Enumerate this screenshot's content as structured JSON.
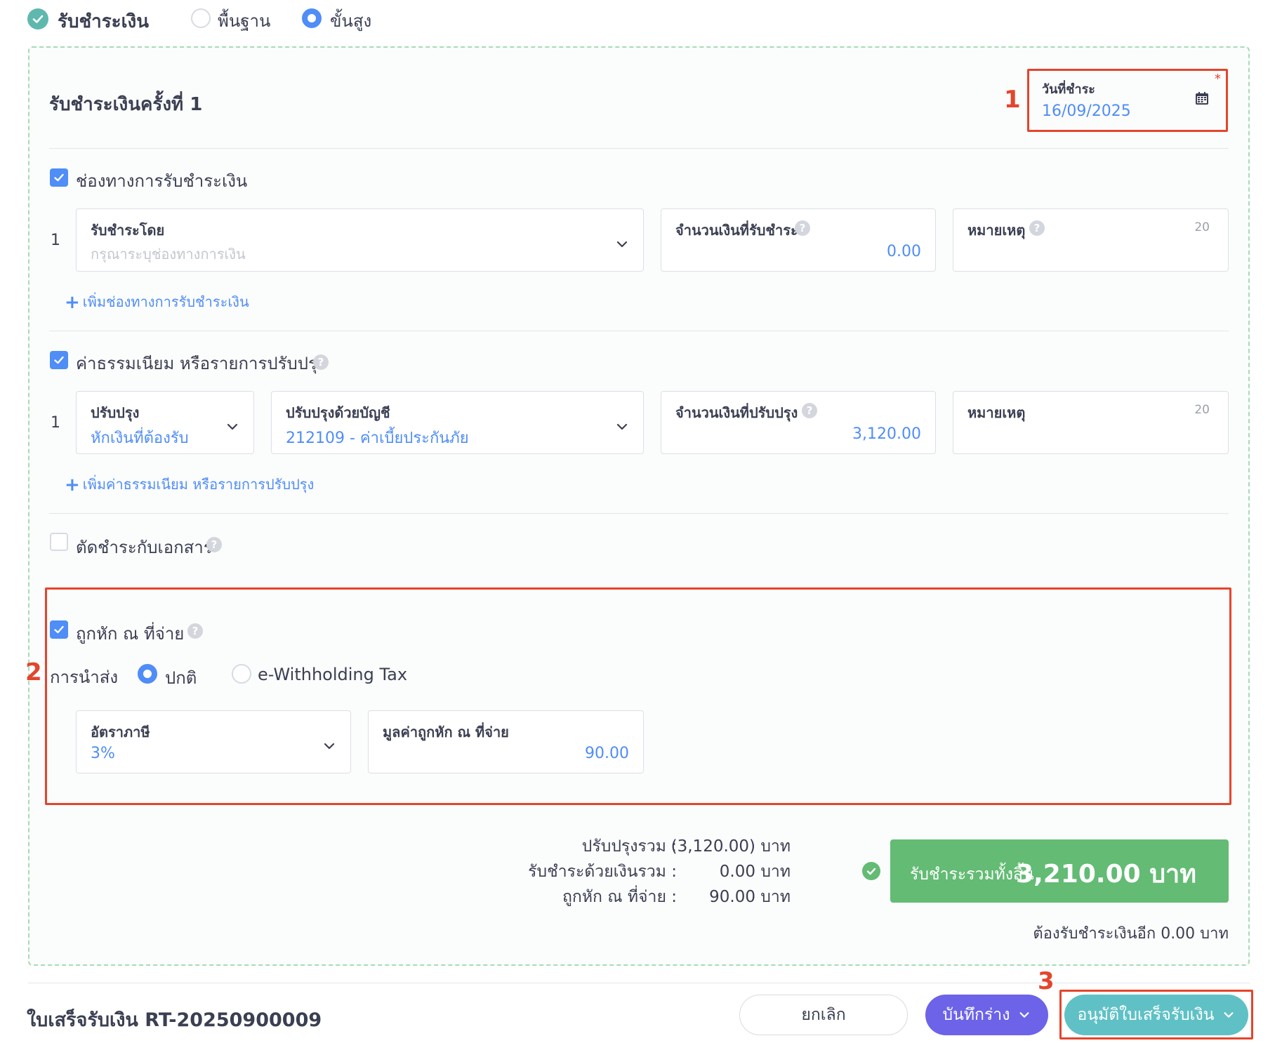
{
  "header": {
    "title": "รับชำระเงิน",
    "mode_basic": "พื้นฐาน",
    "mode_advanced": "ขั้นสูง",
    "selected_mode": "advanced"
  },
  "payment": {
    "section_title": "รับชำระเงินครั้งที่ 1",
    "date_label": "วันที่ชำระ",
    "date_value": "16/09/2025",
    "required_mark": "*"
  },
  "channels": {
    "title": "ช่องทางการรับชำระเงิน",
    "checked": true,
    "row_number": "1",
    "method_label": "รับชำระโดย",
    "method_placeholder": "กรุณาระบุช่องทางการเงิน",
    "amount_label": "จำนวนเงินที่รับชำระ",
    "amount_value": "0.00",
    "note_label": "หมายเหตุ",
    "note_counter": "20",
    "add_link": "เพิ่มช่องทางการรับชำระเงิน"
  },
  "fees": {
    "title": "ค่าธรรมเนียม หรือรายการปรับปรุง",
    "checked": true,
    "row_number": "1",
    "adjust_label": "ปรับปรุง",
    "adjust_value": "หักเงินที่ต้องรับ",
    "account_label": "ปรับปรุงด้วยบัญชี",
    "account_value": "212109 - ค่าเบี้ยประกันภัย",
    "amount_label": "จำนวนเงินที่ปรับปรุง",
    "amount_value": "3,120.00",
    "note_label": "หมายเหตุ",
    "note_counter": "20",
    "add_link": "เพิ่มค่าธรรมเนียม หรือรายการปรับปรุง"
  },
  "offset": {
    "title": "ตัดชำระกับเอกสาร",
    "checked": false
  },
  "withholding": {
    "title": "ถูกหัก ณ ที่จ่าย",
    "checked": true,
    "delivery_label": "การนำส่ง",
    "option_normal": "ปกติ",
    "option_ewht": "e-Withholding Tax",
    "selected_option": "normal",
    "rate_label": "อัตราภาษี",
    "rate_value": "3%",
    "amount_label": "มูลค่าถูกหัก ณ ที่จ่าย",
    "amount_value": "90.00"
  },
  "summary": {
    "adjust_total_label": "ปรับปรุงรวม :",
    "adjust_total_value": "(3,120.00) บาท",
    "cash_total_label": "รับชำระด้วยเงินรวม :",
    "cash_total_value": "0.00 บาท",
    "wht_total_label": "ถูกหัก ณ ที่จ่าย :",
    "wht_total_value": "90.00 บาท",
    "grand_total_label": "รับชำระรวมทั้งสิ้น",
    "grand_total_value": "3,210.00 บาท",
    "remaining": "ต้องรับชำระเงินอีก 0.00 บาท"
  },
  "annotations": {
    "marker_1": "1",
    "marker_2": "2",
    "marker_3": "3"
  },
  "footer": {
    "document_title": "ใบเสร็จรับเงิน RT-20250900009",
    "cancel_label": "ยกเลิก",
    "draft_label": "บันทึกร่าง",
    "approve_label": "อนุมัติใบเสร็จรับเงิน"
  },
  "colors": {
    "accent_blue": "#4f8df7",
    "success_green": "#63bb74",
    "annotation_red": "#e4452c",
    "draft_purple": "#6c63e9",
    "approve_teal": "#5fc1c5"
  },
  "icons": [
    "check-circle-icon",
    "calendar-icon",
    "chevron-down-icon",
    "help-icon",
    "plus-icon",
    "checkbox-check-icon"
  ]
}
